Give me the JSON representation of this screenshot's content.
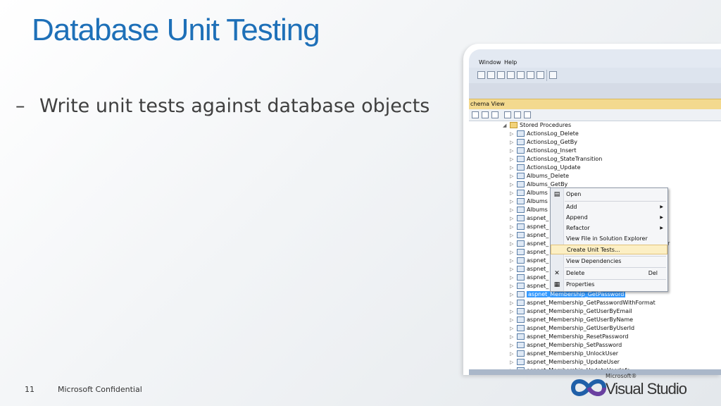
{
  "slide": {
    "title": "Database Unit Testing",
    "bullet_dash": "–",
    "bullet": "Write unit tests against database objects",
    "page_number": "11",
    "confidential": "Microsoft Confidential"
  },
  "logo": {
    "microsoft": "Microsoft®",
    "product": "Visual Studio",
    "colors": {
      "infinity_blue": "#1f5fa8",
      "infinity_purple": "#6a3fa0",
      "text": "#333333"
    }
  },
  "screenshot": {
    "menu": [
      "Window",
      "Help"
    ],
    "panel_title": "chema View",
    "tree": {
      "folder": "Stored Procedures",
      "items": [
        "ActionsLog_Delete",
        "ActionsLog_GetBy",
        "ActionsLog_Insert",
        "ActionsLog_StateTransition",
        "ActionsLog_Update",
        "Albums_Delete",
        "Albums_GetBy",
        "Albums",
        "Albums",
        "Albums",
        "aspnet_",
        "aspnet_",
        "aspnet_",
        "aspnet_",
        "aspnet_",
        "aspnet_",
        "aspnet_",
        "aspnet_",
        "aspnet_",
        "aspnet_Membership_GetPassword",
        "aspnet_Membership_GetPasswordWithFormat",
        "aspnet_Membership_GetUserByEmail",
        "aspnet_Membership_GetUserByName",
        "aspnet_Membership_GetUserByUserId",
        "aspnet_Membership_ResetPassword",
        "aspnet_Membership_SetPassword",
        "aspnet_Membership_UnlockUser",
        "aspnet_Membership_UpdateUser",
        "aspnet_Membership_UpdateUserInfo"
      ],
      "selected": "aspnet_Membership_GetPassword",
      "partial_suffix": "r"
    },
    "context_menu": {
      "open": "Open",
      "add": "Add",
      "append": "Append",
      "refactor": "Refactor",
      "view_in_solution": "View File in Solution Explorer",
      "create_unit_tests": "Create Unit Tests...",
      "view_dependencies": "View Dependencies",
      "delete": "Delete",
      "delete_key": "Del",
      "properties": "Properties",
      "submenu_arrow": "▶"
    }
  }
}
